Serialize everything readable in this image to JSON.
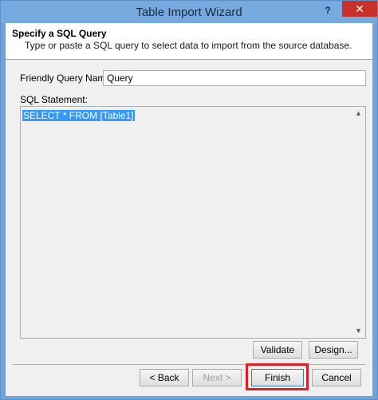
{
  "window": {
    "title": "Table Import Wizard",
    "help_label": "?",
    "close_label": "✕"
  },
  "header": {
    "heading": "Specify a SQL Query",
    "description": "Type or paste a SQL query to select data to import from the source database."
  },
  "form": {
    "friendly_query_name_label": "Friendly Query Name:",
    "friendly_query_name_value": "Query",
    "sql_statement_label": "SQL Statement:",
    "sql_statement_value": "SELECT * FROM [Table1]"
  },
  "buttons": {
    "validate": "Validate",
    "design": "Design...",
    "back": "< Back",
    "next": "Next >",
    "finish": "Finish",
    "cancel": "Cancel"
  },
  "scrollbar": {
    "up_icon": "▲",
    "down_icon": "▼"
  },
  "colors": {
    "title_bar": "#76a9dd",
    "close_button": "#c9302c",
    "selection": "#3399ff",
    "highlight_box": "#e02020"
  }
}
